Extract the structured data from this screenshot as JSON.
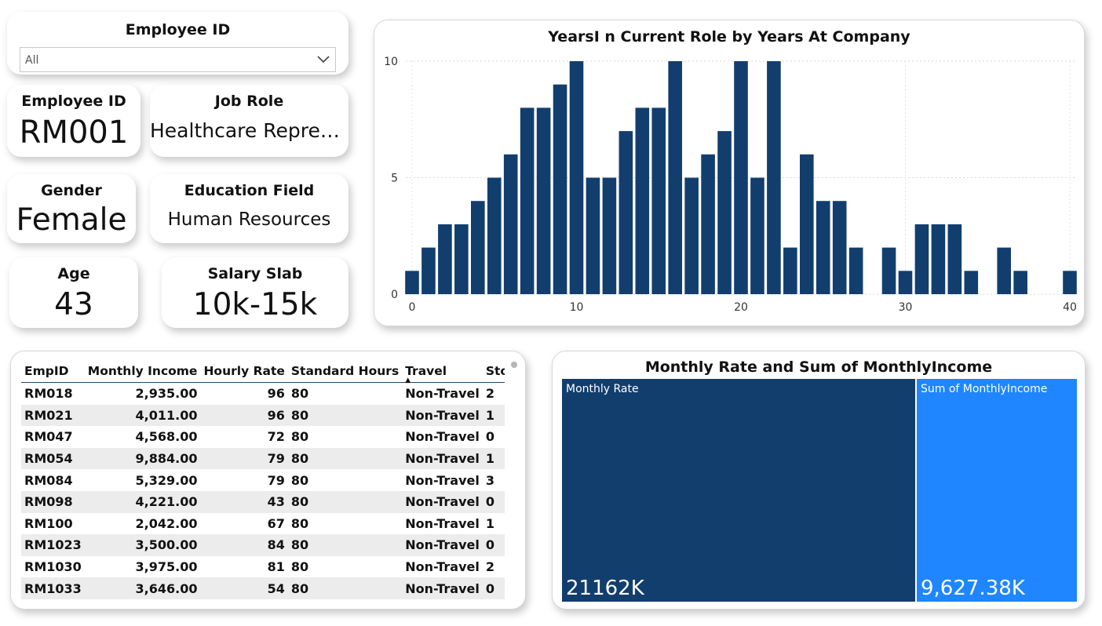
{
  "slicer": {
    "title": "Employee ID",
    "selected": "All",
    "icon": "chevron-down-icon"
  },
  "cards": {
    "employee_id": {
      "title": "Employee ID",
      "value": "RM001"
    },
    "job_role": {
      "title": "Job Role",
      "value": "Healthcare Repres..."
    },
    "gender": {
      "title": "Gender",
      "value": "Female"
    },
    "education_field": {
      "title": "Education Field",
      "value": "Human Resources"
    },
    "age": {
      "title": "Age",
      "value": "43"
    },
    "salary_slab": {
      "title": "Salary Slab",
      "value": "10k-15k"
    }
  },
  "bar_chart_labels": {
    "x_ticks": [
      "0",
      "10",
      "20",
      "30",
      "40"
    ],
    "y_ticks": [
      "0",
      "5",
      "10"
    ]
  },
  "chart_data": {
    "type": "bar",
    "title": "YearsI n Current Role by Years At Company",
    "xlabel": "",
    "ylabel": "",
    "x": [
      0,
      1,
      2,
      3,
      4,
      5,
      6,
      7,
      8,
      9,
      10,
      11,
      12,
      13,
      14,
      15,
      16,
      17,
      18,
      19,
      20,
      21,
      22,
      23,
      24,
      25,
      26,
      27,
      29,
      30,
      31,
      32,
      33,
      34,
      36,
      37,
      40
    ],
    "values": [
      1,
      2,
      3,
      3,
      4,
      5,
      6,
      8,
      8,
      9,
      10,
      5,
      5,
      7,
      8,
      8,
      10,
      5,
      6,
      7,
      10,
      5,
      10,
      2,
      6,
      4,
      4,
      2,
      2,
      1,
      3,
      3,
      3,
      1,
      2,
      1,
      1
    ],
    "xlim": [
      0,
      40
    ],
    "ylim": [
      0,
      10
    ],
    "grid": true,
    "color": "#123e6e"
  },
  "table": {
    "columns": [
      "EmpID",
      "Monthly Income",
      "Hourly Rate",
      "Standard Hours",
      "Travel",
      "Stock"
    ],
    "sorted_column": "Travel",
    "rows": [
      [
        "RM018",
        "2,935.00",
        "96",
        "80",
        "Non-Travel",
        "2"
      ],
      [
        "RM021",
        "4,011.00",
        "96",
        "80",
        "Non-Travel",
        "1"
      ],
      [
        "RM047",
        "4,568.00",
        "72",
        "80",
        "Non-Travel",
        "0"
      ],
      [
        "RM054",
        "9,884.00",
        "79",
        "80",
        "Non-Travel",
        "1"
      ],
      [
        "RM084",
        "5,329.00",
        "79",
        "80",
        "Non-Travel",
        "3"
      ],
      [
        "RM098",
        "4,221.00",
        "43",
        "80",
        "Non-Travel",
        "0"
      ],
      [
        "RM100",
        "2,042.00",
        "67",
        "80",
        "Non-Travel",
        "1"
      ],
      [
        "RM1023",
        "3,500.00",
        "84",
        "80",
        "Non-Travel",
        "0"
      ],
      [
        "RM1030",
        "3,975.00",
        "81",
        "80",
        "Non-Travel",
        "2"
      ],
      [
        "RM1033",
        "3,646.00",
        "54",
        "80",
        "Non-Travel",
        "0"
      ]
    ]
  },
  "treemap": {
    "title": "Monthly Rate and Sum of MonthlyIncome",
    "tiles": [
      {
        "label": "Monthly Rate",
        "value": "21162K",
        "color": "#123e6e"
      },
      {
        "label": "Sum of MonthlyIncome",
        "value": "9,627.38K",
        "color": "#1f86ff"
      }
    ]
  }
}
